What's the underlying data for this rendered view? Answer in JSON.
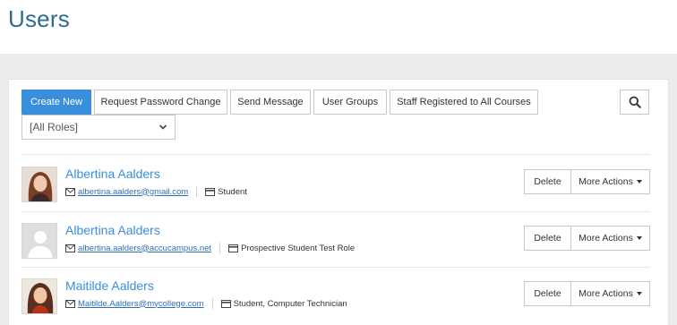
{
  "page": {
    "title": "Users"
  },
  "toolbar": {
    "create_new": "Create New",
    "request_password_change": "Request Password Change",
    "send_message": "Send Message",
    "user_groups": "User Groups",
    "staff_registered": "Staff Registered to All Courses"
  },
  "filter": {
    "role_selected": "[All Roles]"
  },
  "users": [
    {
      "name": "Albertina Aalders",
      "email": "albertina.aalders@gmail.com",
      "roles": "Student",
      "avatar": "photo-female-1"
    },
    {
      "name": "Albertina Aalders",
      "email": "albertina.aalders@accucampus.net",
      "roles": "Prospective Student Test Role",
      "avatar": "placeholder"
    },
    {
      "name": "Maitilde Aalders",
      "email": "Maitilde.Aalders@mycollege.com",
      "roles": "Student, Computer Technician",
      "avatar": "photo-female-2"
    }
  ],
  "row_actions": {
    "delete": "Delete",
    "more_actions": "More Actions"
  },
  "colors": {
    "accent": "#3a8fdc",
    "title": "#2f6c95",
    "band": "#ececec"
  }
}
